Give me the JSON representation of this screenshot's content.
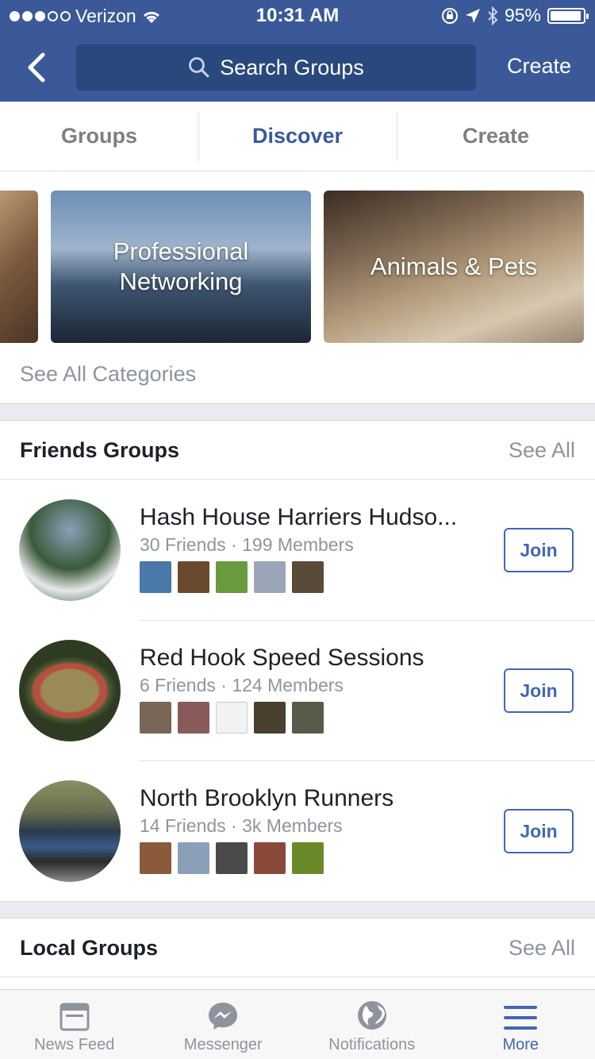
{
  "status_bar": {
    "carrier": "Verizon",
    "signal_dots_filled": 3,
    "signal_dots_total": 5,
    "time": "10:31 AM",
    "battery": "95%",
    "battery_level": 0.95,
    "icons": [
      "wifi-icon",
      "orientation-lock-icon",
      "location-icon",
      "bluetooth-icon",
      "battery-icon"
    ]
  },
  "header": {
    "back_icon": "chevron-left-icon",
    "search_placeholder": "Search Groups",
    "create_label": "Create",
    "color": "#3b5998",
    "search_bg": "#29487d"
  },
  "tabs": [
    {
      "label": "Groups",
      "active": false
    },
    {
      "label": "Discover",
      "active": true
    },
    {
      "label": "Create",
      "active": false
    }
  ],
  "categories": {
    "items": [
      {
        "label": ""
      },
      {
        "label": "Professional Networking"
      },
      {
        "label": "Animals & Pets"
      }
    ],
    "see_all_label": "See All Categories"
  },
  "friends_groups": {
    "title": "Friends Groups",
    "see_all": "See All",
    "groups": [
      {
        "name": "Hash House Harriers Hudso...",
        "meta": "30 Friends · 199 Members",
        "join_label": "Join",
        "thumb_colors": [
          "#4a78a8",
          "#6a4a2e",
          "#6a9a3e",
          "#9aa6b8",
          "#5a4a3a"
        ]
      },
      {
        "name": "Red Hook Speed Sessions",
        "meta": "6 Friends · 124 Members",
        "join_label": "Join",
        "thumb_colors": [
          "#7a6656",
          "#8a5a5a",
          "#f2f2f2",
          "#4a4030",
          "#5a5a4a"
        ]
      },
      {
        "name": "North Brooklyn Runners",
        "meta": "14 Friends · 3k Members",
        "join_label": "Join",
        "thumb_colors": [
          "#8a5a3a",
          "#8aa0b8",
          "#4a4a4a",
          "#8a4a3a",
          "#6a8a2a"
        ]
      }
    ]
  },
  "local_groups": {
    "title": "Local Groups",
    "see_all": "See All"
  },
  "bottom_nav": [
    {
      "label": "News Feed",
      "icon": "news-feed-icon",
      "active": false
    },
    {
      "label": "Messenger",
      "icon": "messenger-icon",
      "active": false
    },
    {
      "label": "Notifications",
      "icon": "globe-icon",
      "active": false
    },
    {
      "label": "More",
      "icon": "menu-icon",
      "active": true
    }
  ]
}
